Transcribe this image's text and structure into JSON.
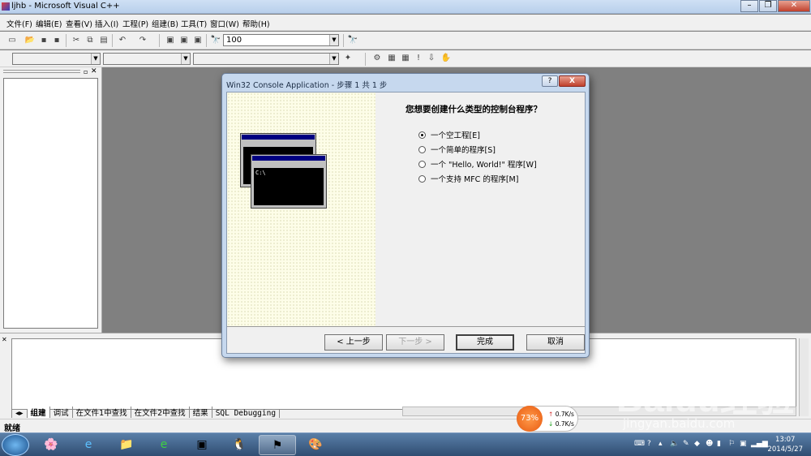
{
  "window": {
    "title": "ljhb - Microsoft Visual C++"
  },
  "menu": [
    "文件(F)",
    "编辑(E)",
    "查看(V)",
    "插入(I)",
    "工程(P)",
    "组建(B)",
    "工具(T)",
    "窗口(W)",
    "帮助(H)"
  ],
  "toolbar": {
    "find_combo_value": "100"
  },
  "dialog": {
    "title": "Win32 Console Application - 步骤 1 共 1 步",
    "help_label": "?",
    "close_label": "X",
    "question": "您想要创建什么类型的控制台程序？",
    "options": [
      {
        "label": "一个空工程[E]",
        "selected": true
      },
      {
        "label": "一个简单的程序[S]",
        "selected": false
      },
      {
        "label": "一个 \"Hello, World!\" 程序[W]",
        "selected": false
      },
      {
        "label": "一个支持 MFC 的程序[M]",
        "selected": false
      }
    ],
    "preview_console_text": "C:\\",
    "buttons": {
      "back": "< 上一步",
      "next": "下一步 >",
      "finish": "完成",
      "cancel": "取消"
    }
  },
  "output": {
    "tabs": [
      "组建",
      "调试",
      "在文件1中查找",
      "在文件2中查找",
      "结果",
      "SQL Debugging"
    ]
  },
  "status": {
    "text": "就绪"
  },
  "net_widget": {
    "percent": "73%",
    "up": "0.7K/s",
    "down": "0.7K/s"
  },
  "taskbar": {
    "time": "13:07",
    "date": "2014/5/27"
  },
  "watermark": {
    "logo": "Baidu经验",
    "url": "jingyan.baidu.com"
  }
}
